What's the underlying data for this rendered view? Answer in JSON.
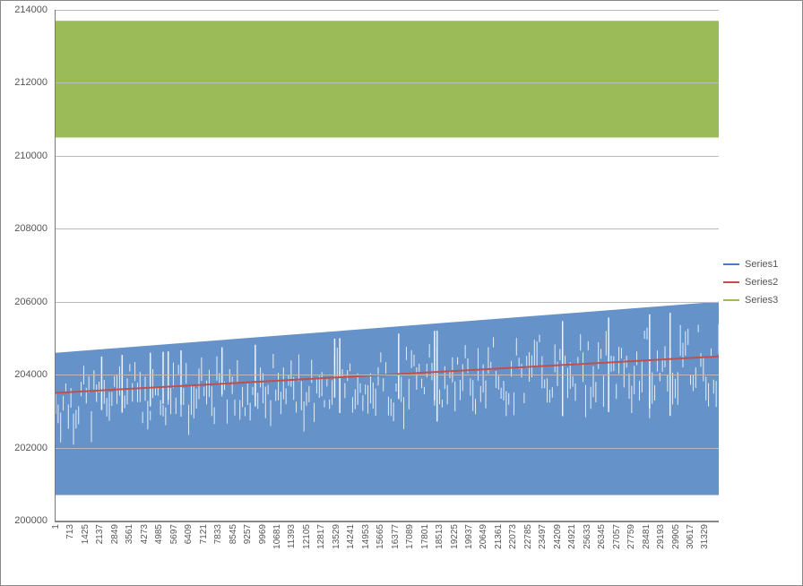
{
  "chart_data": {
    "type": "line",
    "xlabel": "",
    "ylabel": "",
    "ylim": [
      200000,
      214000
    ],
    "x_tick_labels": [
      "1",
      "713",
      "1425",
      "2137",
      "2849",
      "3561",
      "4273",
      "4985",
      "5697",
      "6409",
      "7121",
      "7833",
      "8545",
      "9257",
      "9969",
      "10681",
      "11393",
      "12105",
      "12817",
      "13529",
      "14241",
      "14953",
      "15665",
      "16377",
      "17089",
      "17801",
      "18513",
      "19225",
      "19937",
      "20649",
      "21361",
      "22073",
      "22785",
      "23497",
      "24209",
      "24921",
      "25633",
      "26345",
      "27057",
      "27759",
      "28481",
      "29193",
      "29905",
      "30617",
      "31329"
    ],
    "y_tick_labels": [
      "200000",
      "202000",
      "204000",
      "206000",
      "208000",
      "210000",
      "212000",
      "214000"
    ],
    "x_range": [
      1,
      32000
    ],
    "series": [
      {
        "name": "Series1",
        "color": "#4a7fbf",
        "description": "noisy data oscillating densely; lower baseline ~200700 constant, upper envelope rising from ~204600 to ~206000",
        "envelope": {
          "lower": {
            "start_x": 1,
            "start_y": 200700,
            "end_x": 32000,
            "end_y": 200700
          },
          "upper": {
            "start_x": 1,
            "start_y": 204600,
            "end_x": 32000,
            "end_y": 206000
          }
        }
      },
      {
        "name": "Series2",
        "color": "#c0504d",
        "description": "straight line trend",
        "line": {
          "start_x": 1,
          "start_y": 203500,
          "end_x": 32000,
          "end_y": 204500
        }
      },
      {
        "name": "Series3",
        "color": "#9bbb59",
        "description": "filled band between two constants",
        "band": {
          "low": 210500,
          "high": 213700
        }
      }
    ]
  },
  "legend": {
    "items": [
      {
        "label": "Series1",
        "color": "#4a7fbf"
      },
      {
        "label": "Series2",
        "color": "#c0504d"
      },
      {
        "label": "Series3",
        "color": "#9bbb59"
      }
    ]
  }
}
